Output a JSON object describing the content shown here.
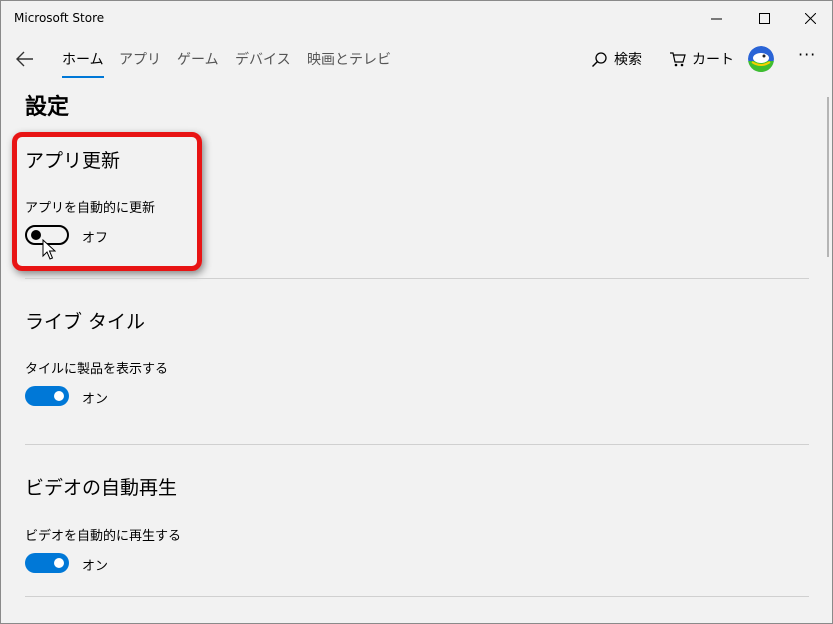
{
  "window": {
    "title": "Microsoft Store"
  },
  "nav": {
    "tabs": [
      {
        "label": "ホーム",
        "active": true
      },
      {
        "label": "アプリ",
        "active": false
      },
      {
        "label": "ゲーム",
        "active": false
      },
      {
        "label": "デバイス",
        "active": false
      },
      {
        "label": "映画とテレビ",
        "active": false
      }
    ],
    "search_label": "検索",
    "cart_label": "カート",
    "more_label": "···"
  },
  "page": {
    "title": "設定",
    "sections": [
      {
        "title": "アプリ更新",
        "setting_label": "アプリを自動的に更新",
        "state_label": "オフ",
        "on": false
      },
      {
        "title": "ライブ タイル",
        "setting_label": "タイルに製品を表示する",
        "state_label": "オン",
        "on": true
      },
      {
        "title": "ビデオの自動再生",
        "setting_label": "ビデオを自動的に再生する",
        "state_label": "オン",
        "on": true
      }
    ]
  },
  "colors": {
    "accent": "#0078d7",
    "highlight": "#e81414",
    "background": "#f2f2f2"
  }
}
